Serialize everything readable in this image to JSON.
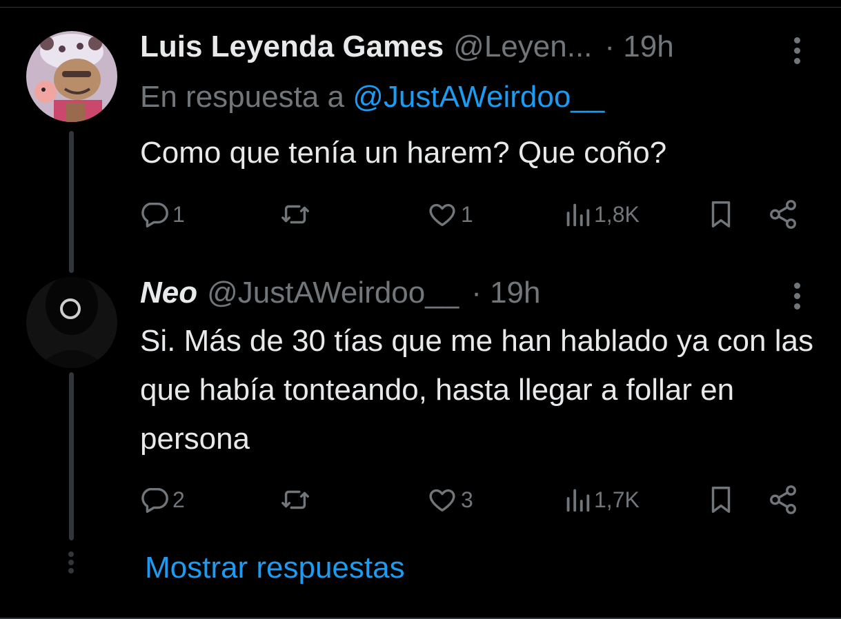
{
  "colors": {
    "background": "#000000",
    "text": "#e7e9ea",
    "muted": "#71767b",
    "accent": "#1d9bf0",
    "line": "#333639"
  },
  "tweets": [
    {
      "name": "Luis Leyenda Games",
      "handle": "@Leyen...",
      "time": "· 19h",
      "reply_prefix": "En respuesta a ",
      "reply_mention": "@JustAWeirdoo__",
      "text": "Como que tenía un harem? Que coño?",
      "replies": "1",
      "retweets": "",
      "likes": "1",
      "views": "1,8K",
      "avatar_icon": "cartoon-character-avatar"
    },
    {
      "name": "Neo",
      "handle": "@JustAWeirdoo__",
      "time": "· 19h",
      "text": "Si. Más de 30 tías que me han hablado ya con las que había tonteando, hasta llegar a follar en persona",
      "replies": "2",
      "retweets": "",
      "likes": "3",
      "views": "1,7K",
      "avatar_icon": "dark-masked-figure-avatar"
    }
  ],
  "show_replies_label": "Mostrar respuestas",
  "icons": [
    "reply-icon",
    "retweet-icon",
    "like-icon",
    "views-icon",
    "bookmark-icon",
    "share-icon",
    "more-icon"
  ]
}
